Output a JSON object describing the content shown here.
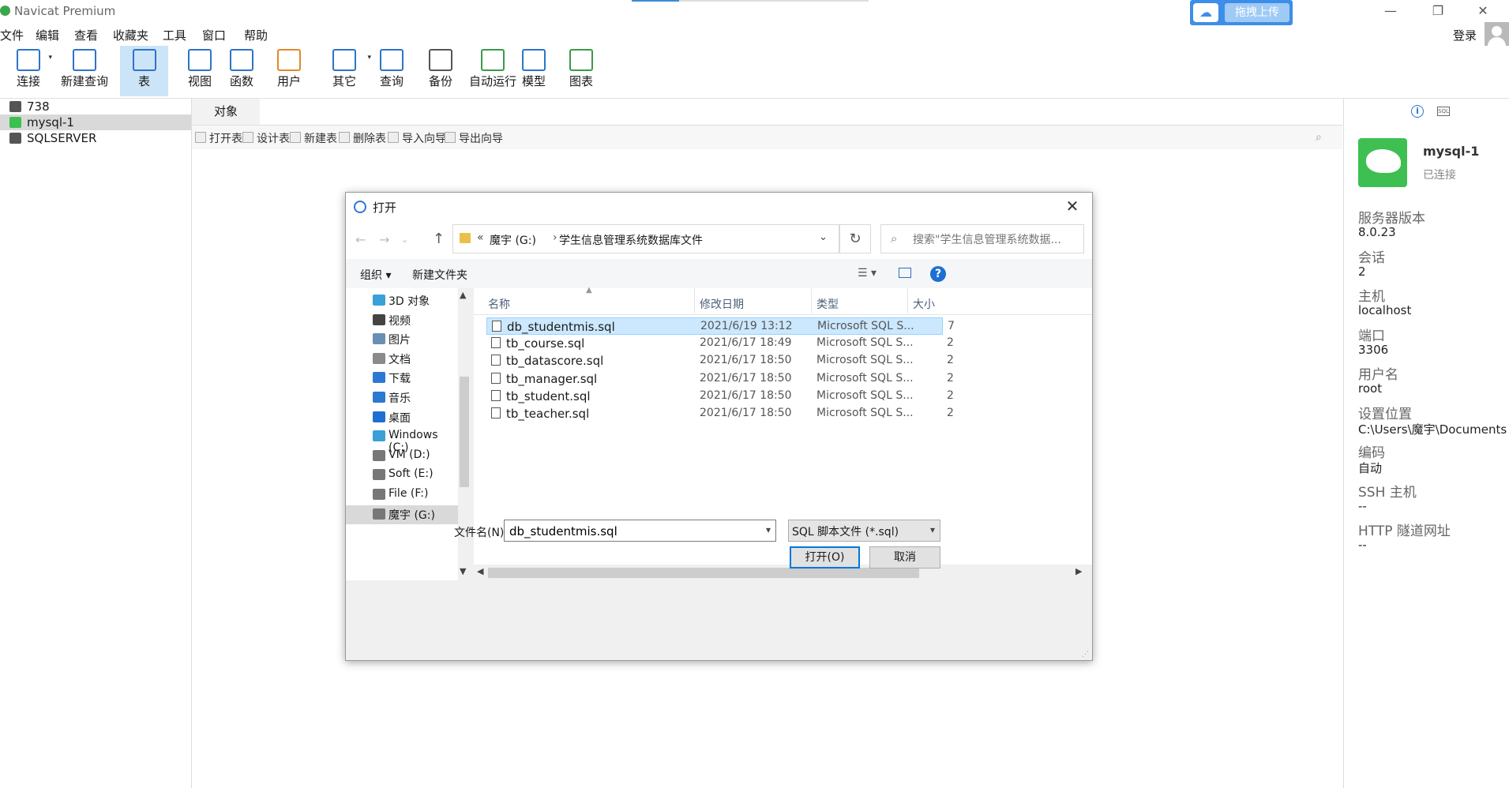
{
  "app": {
    "title": "Navicat Premium",
    "upload_label": "拖拽上传",
    "login_label": "登录"
  },
  "menu": [
    "文件",
    "编辑",
    "查看",
    "收藏夹",
    "工具",
    "窗口",
    "帮助"
  ],
  "toolbar": [
    {
      "label": "连接",
      "icon": "connect-icon"
    },
    {
      "label": "新建查询",
      "icon": "new-query-icon"
    },
    {
      "label": "表",
      "icon": "table-icon",
      "active": true
    },
    {
      "label": "视图",
      "icon": "view-icon"
    },
    {
      "label": "函数",
      "icon": "function-icon"
    },
    {
      "label": "用户",
      "icon": "user-icon"
    },
    {
      "label": "其它",
      "icon": "other-icon"
    },
    {
      "label": "查询",
      "icon": "query-icon"
    },
    {
      "label": "备份",
      "icon": "backup-icon"
    },
    {
      "label": "自动运行",
      "icon": "auto-run-icon"
    },
    {
      "label": "模型",
      "icon": "model-icon"
    },
    {
      "label": "图表",
      "icon": "chart-icon"
    }
  ],
  "tree": [
    {
      "label": "738",
      "color": "#555555"
    },
    {
      "label": "mysql-1",
      "color": "#3ebf51",
      "selected": true
    },
    {
      "label": "SQLSERVER",
      "color": "#555555"
    }
  ],
  "objects": {
    "tab_label": "对象",
    "buttons": [
      "打开表",
      "设计表",
      "新建表",
      "删除表",
      "导入向导",
      "导出向导"
    ]
  },
  "info": {
    "name": "mysql-1",
    "status": "已连接",
    "fields": [
      {
        "label": "服务器版本",
        "value": "8.0.23"
      },
      {
        "label": "会话",
        "value": "2"
      },
      {
        "label": "主机",
        "value": "localhost"
      },
      {
        "label": "端口",
        "value": "3306"
      },
      {
        "label": "用户名",
        "value": "root"
      },
      {
        "label": "设置位置",
        "value": "C:\\Users\\魔宇\\Documents"
      },
      {
        "label": "编码",
        "value": "自动"
      },
      {
        "label": "SSH 主机",
        "value": "--"
      },
      {
        "label": "HTTP 隧道网址",
        "value": "--"
      }
    ]
  },
  "dialog": {
    "title": "打开",
    "address": {
      "drive": "魔宇 (G:)",
      "folder": "学生信息管理系统数据库文件"
    },
    "search_placeholder": "搜索\"学生信息管理系统数据...",
    "commands": {
      "organize": "组织 ▾",
      "new_folder": "新建文件夹"
    },
    "nav": [
      {
        "label": "3D 对象",
        "color": "#3aa0d8"
      },
      {
        "label": "视频",
        "color": "#444444"
      },
      {
        "label": "图片",
        "color": "#6a8fb5"
      },
      {
        "label": "文档",
        "color": "#8a8a8a"
      },
      {
        "label": "下载",
        "color": "#2b79d3"
      },
      {
        "label": "音乐",
        "color": "#2b79d3"
      },
      {
        "label": "桌面",
        "color": "#1f6fd1"
      },
      {
        "label": "Windows (C:)",
        "color": "#3aa0d8"
      },
      {
        "label": "VM (D:)",
        "color": "#777777"
      },
      {
        "label": "Soft (E:)",
        "color": "#777777"
      },
      {
        "label": "File (F:)",
        "color": "#777777"
      },
      {
        "label": "魔宇 (G:)",
        "color": "#777777",
        "selected": true
      }
    ],
    "columns": [
      "名称",
      "修改日期",
      "类型",
      "大小"
    ],
    "files": [
      {
        "name": "db_studentmis.sql",
        "date": "2021/6/19 13:12",
        "type": "Microsoft SQL S...",
        "size": "7",
        "selected": true
      },
      {
        "name": "tb_course.sql",
        "date": "2021/6/17 18:49",
        "type": "Microsoft SQL S...",
        "size": "2"
      },
      {
        "name": "tb_datascore.sql",
        "date": "2021/6/17 18:50",
        "type": "Microsoft SQL S...",
        "size": "2"
      },
      {
        "name": "tb_manager.sql",
        "date": "2021/6/17 18:50",
        "type": "Microsoft SQL S...",
        "size": "2"
      },
      {
        "name": "tb_student.sql",
        "date": "2021/6/17 18:50",
        "type": "Microsoft SQL S...",
        "size": "2"
      },
      {
        "name": "tb_teacher.sql",
        "date": "2021/6/17 18:50",
        "type": "Microsoft SQL S...",
        "size": "2"
      }
    ],
    "filename_label": "文件名(N):",
    "filename_value": "db_studentmis.sql",
    "filetype_value": "SQL 脚本文件 (*.sql)",
    "open_label": "打开(O)",
    "cancel_label": "取消"
  }
}
